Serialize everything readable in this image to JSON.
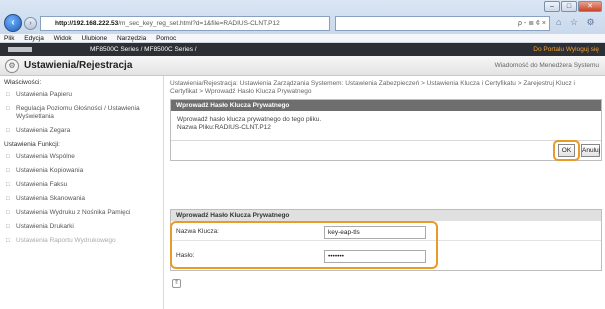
{
  "browser": {
    "url_host": "http://192.168.222.53",
    "url_rest": "/m_sec_key_reg_set.html?d=1&file=RADIUS-CLNT.P12",
    "search_tools": "ρ - ≣ ¢ ×",
    "toolbar_icons": "⌂ ☆ ⚙",
    "window_min": "–",
    "window_max": "□",
    "window_close": "✕"
  },
  "menu": [
    "Plik",
    "Edycja",
    "Widok",
    "Ulubione",
    "Narzędzia",
    "Pomoc"
  ],
  "device": {
    "title": "MF8500C Series / MF8500C Series /",
    "portal_links": "Do Portalu  Wyloguj się"
  },
  "page": {
    "title": "Ustawienia/Rejestracja",
    "admin_message": "Wiadomość do Menedżera Systemu"
  },
  "sidebar": {
    "items": [
      {
        "type": "group",
        "label": "Właściwości:"
      },
      {
        "type": "item",
        "label": "Ustawienia Papieru"
      },
      {
        "type": "item",
        "label": "Regulacja Poziomu Głośności / Ustawienia Wyświetlania"
      },
      {
        "type": "item",
        "label": "Ustawienia Zegara"
      },
      {
        "type": "group",
        "label": "Ustawienia Funkcji:"
      },
      {
        "type": "item",
        "label": "Ustawienia Wspólne"
      },
      {
        "type": "item",
        "label": "Ustawienia Kopiowania"
      },
      {
        "type": "item",
        "label": "Ustawienia Faksu"
      },
      {
        "type": "item",
        "label": "Ustawienia Skanowania"
      },
      {
        "type": "item",
        "label": "Ustawienia Wydruku z Nośnika Pamięci"
      },
      {
        "type": "item",
        "label": "Ustawienia Drukarki"
      },
      {
        "type": "item",
        "label": "Ustawienia Raportu Wydrukowego"
      }
    ]
  },
  "breadcrumb": "Ustawienia/Rejestracja: Ustawienia Zarządzania Systemem: Ustawienia Zabezpieczeń > Ustawienia Klucza i Certyfikatu > Zarejestruj Klucz i Certyfikat > Wprowadź Hasło Klucza Prywatnego",
  "dialog": {
    "header": "Wprowadź Hasło Klucza Prywatnego",
    "line1": "Wprowadź hasło klucza prywatnego do tego pliku.",
    "line2": "Nazwa Pliku:RADIUS-CLNT.P12",
    "ok_label": "OK",
    "cancel_label": "Anuluj"
  },
  "form": {
    "header": "Wprowadź Hasło Klucza Prywatnego",
    "key_name_label": "Nazwa Klucza:",
    "key_name_value": "key-eap-tls",
    "password_label": "Hasło:",
    "password_value": "•••••••"
  },
  "footer": {
    "top_icon": "⇑"
  }
}
